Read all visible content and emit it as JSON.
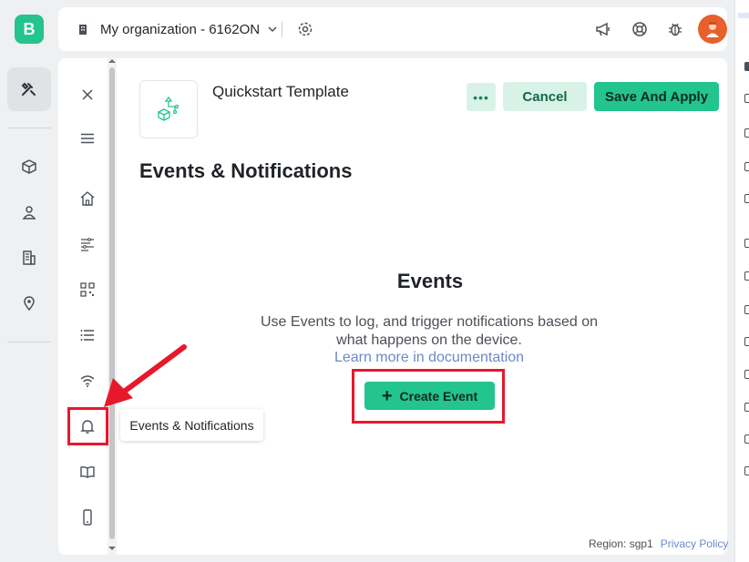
{
  "app": {
    "logo_letter": "B"
  },
  "topbar": {
    "org_name": "My organization - 6162ON",
    "icons": [
      "building-icon",
      "chevron-down-icon",
      "gear-icon",
      "megaphone-icon",
      "lifebuoy-icon",
      "bug-icon",
      "avatar"
    ]
  },
  "rail": {
    "items": [
      "tools-icon",
      "cube-icon",
      "user-location-icon",
      "office-icon",
      "map-pin-icon"
    ]
  },
  "sidebar": {
    "items": [
      "close-icon",
      "menu-icon",
      "home-icon",
      "datastreams-icon",
      "qr-code-icon",
      "list-icon",
      "wifi-icon",
      "bell-icon",
      "book-icon",
      "mobile-icon"
    ],
    "tooltip": "Events & Notifications"
  },
  "template": {
    "name": "Quickstart Template"
  },
  "actions": {
    "more": "•••",
    "cancel": "Cancel",
    "save": "Save And Apply"
  },
  "page": {
    "title": "Events & Notifications"
  },
  "empty_state": {
    "title": "Events",
    "description": "Use Events to log, and trigger notifications based on what happens on the device.",
    "learn_more": "Learn more in documentation",
    "create_button": "Create Event",
    "create_icon": "+"
  },
  "footer": {
    "region": "Region: sgp1",
    "privacy": "Privacy Policy"
  },
  "colors": {
    "accent": "#23c48e",
    "highlight": "#e8182b",
    "link": "#6b89c8"
  }
}
